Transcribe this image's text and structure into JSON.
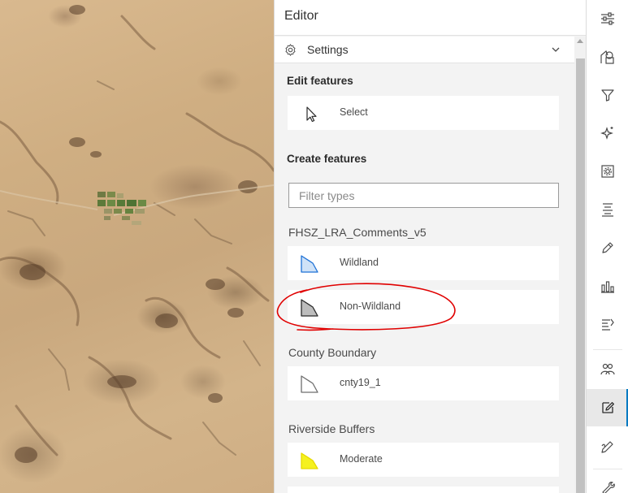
{
  "editor": {
    "title": "Editor",
    "settings_label": "Settings",
    "edit_features": {
      "title": "Edit features",
      "select_label": "Select"
    },
    "create_features": {
      "title": "Create features",
      "filter_placeholder": "Filter types"
    },
    "layers": [
      {
        "name": "FHSZ_LRA_Comments_v5",
        "templates": [
          {
            "label": "Wildland",
            "symbol": "polygon",
            "fill": "#cfe2f7",
            "stroke": "#1f72d6"
          },
          {
            "label": "Non-Wildland",
            "symbol": "polygon",
            "fill": "#bdbdbd",
            "stroke": "#2b2b2b"
          }
        ]
      },
      {
        "name": "County Boundary",
        "templates": [
          {
            "label": "cnty19_1",
            "symbol": "polygon",
            "fill": "#ffffff",
            "stroke": "#6e6e6e"
          }
        ]
      },
      {
        "name": "Riverside Buffers",
        "templates": [
          {
            "label": "Moderate",
            "symbol": "polygon",
            "fill": "#f5f11f",
            "stroke": "#e6d900"
          }
        ]
      }
    ]
  },
  "toolbar": {
    "items": [
      {
        "icon": "sliders-icon",
        "active": false
      },
      {
        "icon": "shapes-icon",
        "active": false
      },
      {
        "icon": "filter-icon",
        "active": false
      },
      {
        "icon": "sparkle-icon",
        "active": false
      },
      {
        "icon": "gear-box-icon",
        "active": false
      },
      {
        "icon": "list-align-icon",
        "active": false
      },
      {
        "icon": "pen-tag-icon",
        "active": false
      },
      {
        "icon": "bar-chart-icon",
        "active": false
      },
      {
        "icon": "analysis-icon",
        "active": false
      },
      {
        "icon": "people-icon",
        "active": false
      },
      {
        "icon": "edit-icon",
        "active": true
      },
      {
        "icon": "sketch-icon",
        "active": false
      },
      {
        "icon": "wrench-icon",
        "active": false
      }
    ]
  },
  "colors": {
    "accent": "#007ac2",
    "annotation": "#e00000",
    "panel_bg": "#f3f3f3"
  }
}
